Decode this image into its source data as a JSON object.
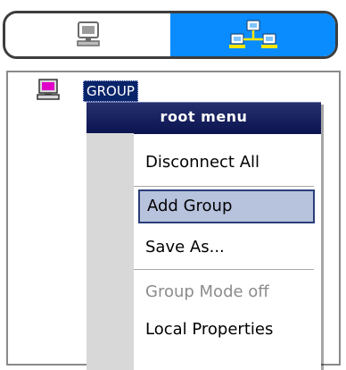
{
  "toggle": {
    "left_icon": "monitor-icon",
    "right_icon": "network-icon",
    "active": "right",
    "active_color": "#0a8cff"
  },
  "tree": {
    "root_icon": "computer-icon",
    "root_label": "GROUP"
  },
  "menu": {
    "title": "root menu",
    "items": [
      {
        "label": "Disconnect All",
        "state": "normal"
      },
      {
        "label": "Add Group",
        "state": "highlighted"
      },
      {
        "label": "Save As...",
        "state": "normal"
      },
      {
        "label": "Group Mode off",
        "state": "disabled"
      },
      {
        "label": "Local Properties",
        "state": "normal"
      }
    ],
    "header_color": "#0b144f",
    "highlight_color": "#b7c2dd"
  }
}
